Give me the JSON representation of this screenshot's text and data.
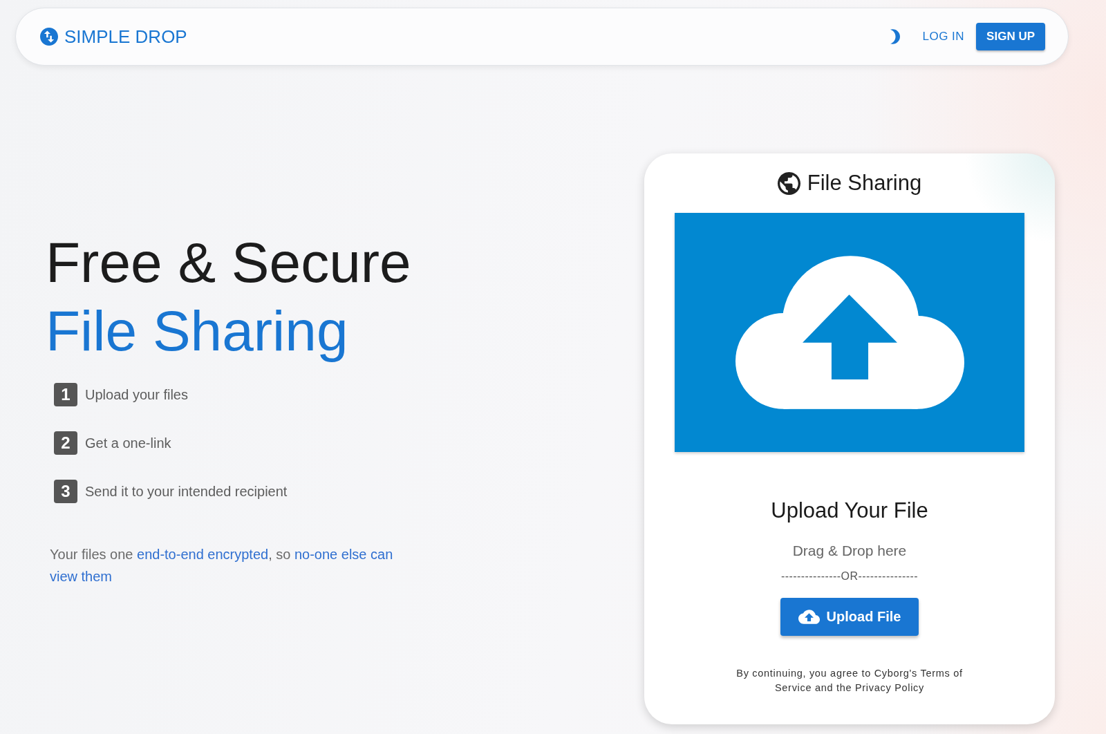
{
  "header": {
    "brand": "SIMPLE DROP",
    "actions": [
      {
        "label": "LOG IN",
        "kind": "text"
      },
      {
        "label": "SIGN UP",
        "kind": "contained"
      }
    ]
  },
  "hero": {
    "title": [
      {
        "text": "Free & Secure",
        "color": "#1c1c1c"
      },
      {
        "text": "File Sharing",
        "color": "#1976d2"
      }
    ],
    "steps": [
      {
        "number": "1",
        "text": "Upload your files"
      },
      {
        "number": "2",
        "text": "Get a one-link"
      },
      {
        "number": "3",
        "text": "Send it to your intended recipient"
      }
    ],
    "note": [
      {
        "text": "Your files one ",
        "kind": "plain"
      },
      {
        "text": "end-to-end encrypted",
        "kind": "link"
      },
      {
        "text": ", so ",
        "kind": "plain"
      },
      {
        "text": "no-one else can",
        "kind": "link"
      },
      {
        "text": "view them",
        "kind": "link"
      }
    ]
  },
  "upload_card": {
    "title": "File Sharing",
    "heading": "Upload Your File",
    "hint": "Drag & Drop here",
    "divider": "---------------OR---------------",
    "button": "Upload File",
    "terms": "By continuing, you agree to Cyborg's Terms of Service and the Privacy Policy"
  }
}
